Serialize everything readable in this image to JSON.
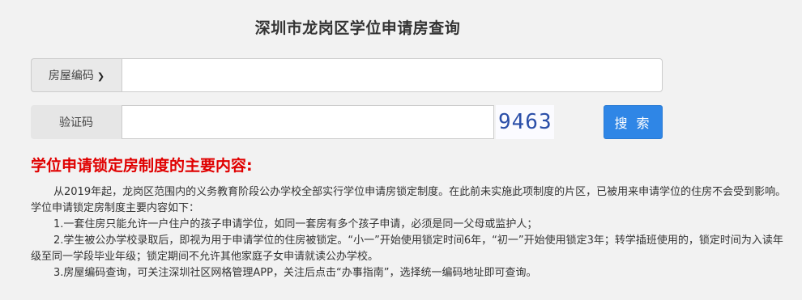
{
  "page": {
    "title": "深圳市龙岗区学位申请房查询"
  },
  "form": {
    "house_code_select": "房屋编码",
    "house_code_input_placeholder": "",
    "captcha_label": "验证码",
    "captcha_input_placeholder": "",
    "captcha_text": "9463",
    "search_button": "搜 索"
  },
  "notice": {
    "heading": "学位申请锁定房制度的主要内容:",
    "intro": "从2019年起，龙岗区范围内的义务教育阶段公办学校全部实行学位申请房锁定制度。在此前未实施此项制度的片区，已被用来申请学位的住房不会受到影响。学位申请锁定房制度主要内容如下：",
    "items": [
      "1.一套住房只能允许一户住户的孩子申请学位，如同一套房有多个孩子申请，必须是同一父母或监护人；",
      "2.学生被公办学校录取后，即视为用于申请学位的住房被锁定。“小一”开始使用锁定时间6年，“初一”开始使用锁定3年；转学插班使用的，锁定时间为入读年级至同一学段毕业年级；锁定期间不允许其他家庭子女申请就读公办学校。",
      "3.房屋编码查询，可关注深圳社区网格管理APP，关注后点击“办事指南”，选择统一编码地址即可查询。"
    ]
  },
  "colors": {
    "background": "#f2f2f2",
    "heading_red": "#e00000",
    "button_blue": "#2f86e6",
    "captcha_blue": "#2b4fa8"
  }
}
